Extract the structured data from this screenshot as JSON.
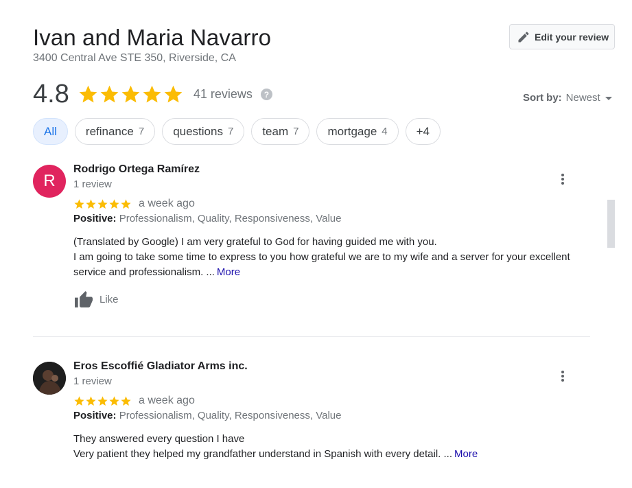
{
  "business": {
    "name": "Ivan and Maria Navarro",
    "address": "3400 Central Ave STE 350, Riverside, CA",
    "rating": "4.8",
    "rating_value": 4.8,
    "review_count_label": "41 reviews",
    "help_icon": "?"
  },
  "edit_review": {
    "label": "Edit your review",
    "icon": "pencil-icon"
  },
  "sort": {
    "label": "Sort by:",
    "value": "Newest"
  },
  "chips": [
    {
      "label": "All",
      "count": ""
    },
    {
      "label": "refinance",
      "count": "7"
    },
    {
      "label": "questions",
      "count": "7"
    },
    {
      "label": "team",
      "count": "7"
    },
    {
      "label": "mortgage",
      "count": "4"
    },
    {
      "label": "+4",
      "count": ""
    }
  ],
  "reviews": [
    {
      "avatar_letter": "R",
      "avatar_color": "#e0245e",
      "name": "Rodrigo Ortega Ramírez",
      "count": "1 review",
      "stars": 5,
      "time": "a week ago",
      "positive_label": "Positive:",
      "positive_values": "Professionalism, Quality, Responsiveness, Value",
      "text_line1": "(Translated by Google) I am very grateful to God for having guided me with you.",
      "text_line2": "I am going to take some time to express to you how grateful we are to my wife and a server for your excellent service and professionalism. ...",
      "more": "More",
      "like_label": "Like"
    },
    {
      "avatar_letter": "",
      "avatar_color": "#2b2b2b",
      "name": "Eros Escoffié Gladiator Arms inc.",
      "count": "1 review",
      "stars": 5,
      "time": "a week ago",
      "positive_label": "Positive:",
      "positive_values": "Professionalism, Quality, Responsiveness, Value",
      "text_line1": "They answered every question I have",
      "text_line2": "Very patient they helped my grandfather understand in Spanish with every detail. ...",
      "more": "More"
    }
  ],
  "colors": {
    "star": "#fbbc04",
    "accent": "#1a73e8",
    "link": "#1a0dab"
  }
}
